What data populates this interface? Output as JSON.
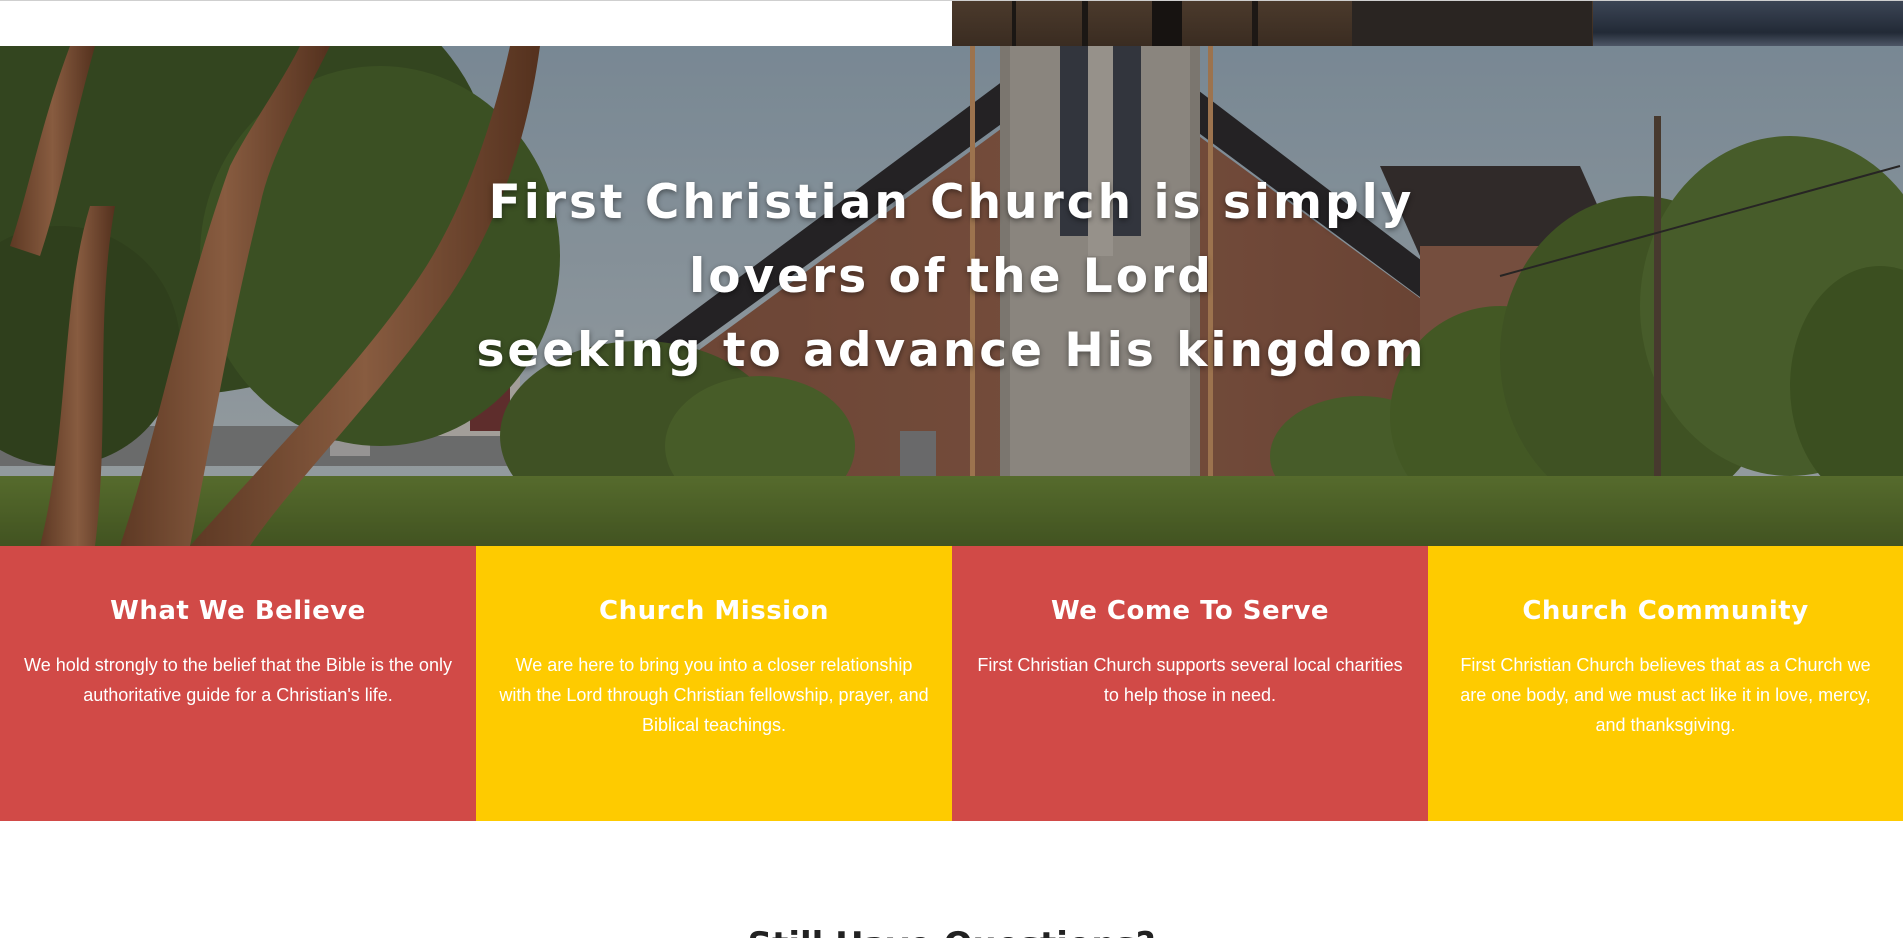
{
  "hero": {
    "title_lines": [
      "First Christian Church is simply",
      "lovers of the Lord",
      "seeking to advance His kingdom"
    ]
  },
  "features": [
    {
      "title": "What We Believe",
      "text": "We hold strongly to the belief that the Bible is the only authoritative guide for a Christian's life.",
      "color": "#d14a47"
    },
    {
      "title": "Church Mission",
      "text": "We are here to bring you into a closer relationship with the Lord through Christian fellowship, prayer, and Biblical teachings.",
      "color": "#fecb00"
    },
    {
      "title": "We Come To Serve",
      "text": "First Christian Church supports several local charities to help those in need.",
      "color": "#d14a47"
    },
    {
      "title": "Church Community",
      "text": "First Christian Church believes that as a Church we are one body, and we must act like it in love, mercy, and thanksgiving.",
      "color": "#fecb00"
    }
  ],
  "questions": {
    "title": "Still Have Questions?"
  }
}
